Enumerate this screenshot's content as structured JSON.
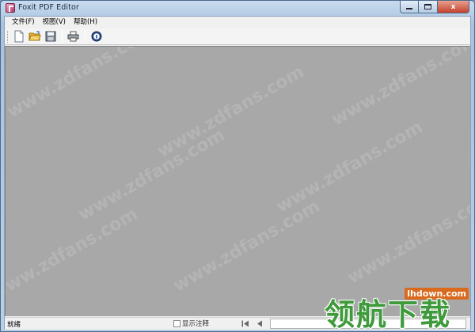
{
  "window": {
    "title": "Foxit PDF Editor",
    "close_glyph": "x"
  },
  "menubar": {
    "items": [
      {
        "label": "文件(F)"
      },
      {
        "label": "视图(V)"
      },
      {
        "label": "帮助(H)"
      }
    ]
  },
  "toolbar": {
    "buttons": [
      {
        "name": "new-document-icon"
      },
      {
        "name": "open-folder-icon"
      },
      {
        "name": "save-disk-icon"
      },
      {
        "name": "print-icon"
      },
      {
        "name": "info-icon"
      }
    ]
  },
  "watermark": {
    "text": "www.zdfans.com"
  },
  "statusbar": {
    "status_text": "就绪",
    "annotation_label": "显示注释",
    "annotation_checked": false
  },
  "branding": {
    "url": "lhdown.com",
    "logo_text": "领航下载"
  },
  "colors": {
    "canvas": "#a8a8a8",
    "chrome": "#f0f0f0",
    "titlebar": "#b9cfe6",
    "close_button": "#c4412c"
  }
}
